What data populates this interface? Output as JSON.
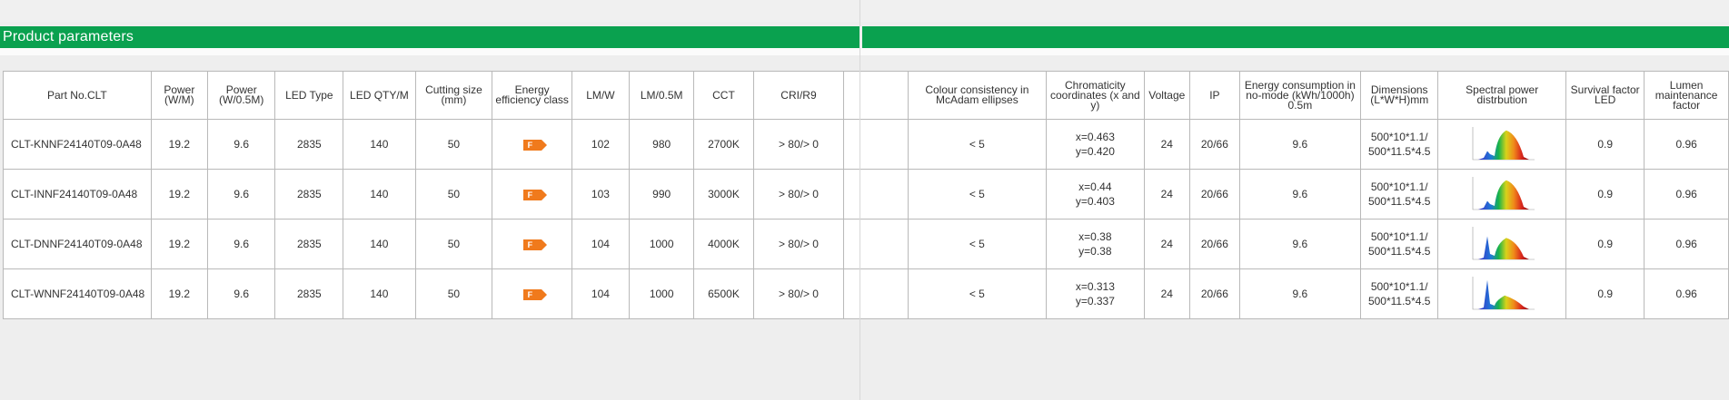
{
  "section_title": "Product parameters",
  "columns": [
    "Part No.CLT",
    "Power (W/M)",
    "Power (W/0.5M)",
    "LED Type",
    "LED QTY/M",
    "Cutting size (mm)",
    "Energy efficiency class",
    "LM/W",
    "LM/0.5M",
    "CCT",
    "CRI/R9",
    "",
    "Colour consistency in McAdam ellipses",
    "Chromaticity coordinates (x and y)",
    "Voltage",
    "IP",
    "Energy consumption in no-mode (kWh/1000h) 0.5m",
    "Dimensions (L*W*H)mm",
    "Spectral power distrbution",
    "Survival factor LED",
    "Lumen maintenance factor"
  ],
  "rows": [
    {
      "part": "CLT-KNNF24140T09-0A48",
      "power_m": "19.2",
      "power_05m": "9.6",
      "led_type": "2835",
      "led_qty": "140",
      "cut": "50",
      "eclass": "F",
      "lmw": "102",
      "lm05": "980",
      "cct": "2700K",
      "cri": "> 80/> 0",
      "blank": "",
      "mcadam": "< 5",
      "coord_x": "x=0.463",
      "coord_y": "y=0.420",
      "voltage": "24",
      "ip": "20/66",
      "energy": "9.6",
      "dim1": "500*10*1.1/",
      "dim2": "500*11.5*4.5",
      "spectrum": "warm-spectrum-chart",
      "survival": "0.9",
      "lumen": "0.96"
    },
    {
      "part": "CLT-INNF24140T09-0A48",
      "power_m": "19.2",
      "power_05m": "9.6",
      "led_type": "2835",
      "led_qty": "140",
      "cut": "50",
      "eclass": "F",
      "lmw": "103",
      "lm05": "990",
      "cct": "3000K",
      "cri": "> 80/> 0",
      "blank": "",
      "mcadam": "< 5",
      "coord_x": "x=0.44",
      "coord_y": "y=0.403",
      "voltage": "24",
      "ip": "20/66",
      "energy": "9.6",
      "dim1": "500*10*1.1/",
      "dim2": "500*11.5*4.5",
      "spectrum": "warm-spectrum-chart",
      "survival": "0.9",
      "lumen": "0.96"
    },
    {
      "part": "CLT-DNNF24140T09-0A48",
      "power_m": "19.2",
      "power_05m": "9.6",
      "led_type": "2835",
      "led_qty": "140",
      "cut": "50",
      "eclass": "F",
      "lmw": "104",
      "lm05": "1000",
      "cct": "4000K",
      "cri": "> 80/> 0",
      "blank": "",
      "mcadam": "< 5",
      "coord_x": "x=0.38",
      "coord_y": "y=0.38",
      "voltage": "24",
      "ip": "20/66",
      "energy": "9.6",
      "dim1": "500*10*1.1/",
      "dim2": "500*11.5*4.5",
      "spectrum": "neutral-spectrum-chart",
      "survival": "0.9",
      "lumen": "0.96"
    },
    {
      "part": "CLT-WNNF24140T09-0A48",
      "power_m": "19.2",
      "power_05m": "9.6",
      "led_type": "2835",
      "led_qty": "140",
      "cut": "50",
      "eclass": "F",
      "lmw": "104",
      "lm05": "1000",
      "cct": "6500K",
      "cri": "> 80/> 0",
      "blank": "",
      "mcadam": "< 5",
      "coord_x": "x=0.313",
      "coord_y": "y=0.337",
      "voltage": "24",
      "ip": "20/66",
      "energy": "9.6",
      "dim1": "500*10*1.1/",
      "dim2": "500*11.5*4.5",
      "spectrum": "cool-spectrum-chart",
      "survival": "0.9",
      "lumen": "0.96"
    }
  ],
  "colors": {
    "brand_green": "#0aa14f",
    "energy_badge": "#f07a1c",
    "grid": "#b9b9b9"
  }
}
